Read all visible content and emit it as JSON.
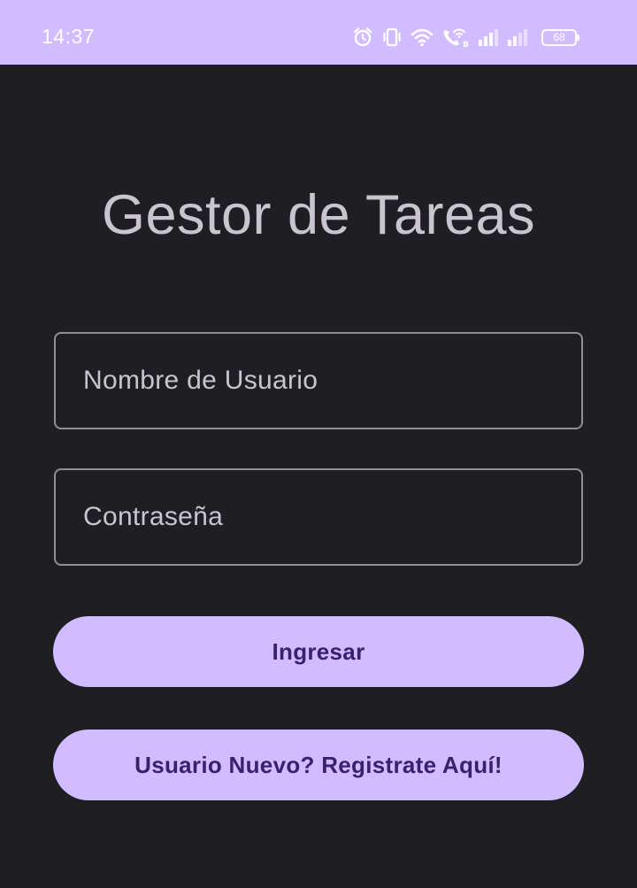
{
  "status_bar": {
    "time": "14:37",
    "battery_level": "68",
    "background": "#d0bcff",
    "icons": [
      "alarm-icon",
      "vibrate-icon",
      "wifi-icon",
      "wifi-calling-icon",
      "signal-1-icon",
      "signal-2-icon",
      "battery-icon"
    ]
  },
  "app": {
    "title": "Gestor de Tareas"
  },
  "form": {
    "username_placeholder": "Nombre de Usuario",
    "password_placeholder": "Contraseña",
    "login_label": "Ingresar",
    "register_label": "Usuario Nuevo? Registrate Aquí!"
  },
  "colors": {
    "background": "#1f1e23",
    "primary": "#d0bcff",
    "on_primary": "#3b2070",
    "outline": "#938f99",
    "on_surface_variant": "#cac4d0"
  }
}
